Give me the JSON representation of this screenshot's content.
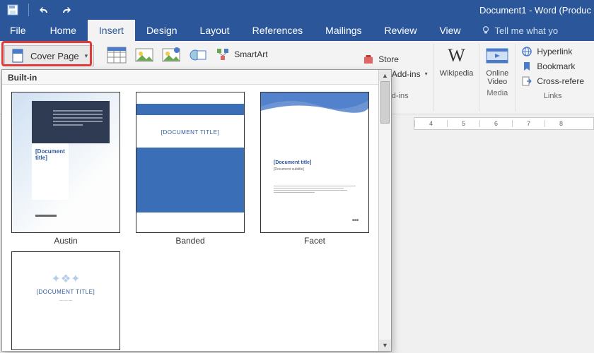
{
  "window": {
    "title": "Document1 - Word (Produc"
  },
  "qat": {
    "save": "Save",
    "undo": "Undo",
    "redo": "Redo"
  },
  "tabs": {
    "file": "File",
    "items": [
      "Home",
      "Insert",
      "Design",
      "Layout",
      "References",
      "Mailings",
      "Review",
      "View"
    ],
    "active_index": 1,
    "tellme": "Tell me what yo"
  },
  "ribbon": {
    "cover_page": "Cover Page",
    "smartart": "SmartArt",
    "store": "Store",
    "my_addins": "My Add-ins",
    "wikipedia": "Wikipedia",
    "online_video": "Online\nVideo",
    "hyperlink": "Hyperlink",
    "bookmark": "Bookmark",
    "crossref": "Cross-refere",
    "group_addins": "Add-ins",
    "group_media": "Media",
    "group_links": "Links"
  },
  "ruler": {
    "marks": [
      "4",
      "5",
      "6",
      "7",
      "8"
    ]
  },
  "gallery": {
    "header": "Built-in",
    "items": [
      {
        "name": "Austin",
        "title_text": "[Document\ntitle]"
      },
      {
        "name": "Banded",
        "title_text": "[DOCUMENT TITLE]"
      },
      {
        "name": "Facet",
        "title_text": "[Document title]",
        "subtitle": "[Document subtitle]"
      },
      {
        "name": "",
        "title_text": "[DOCUMENT TITLE]"
      }
    ]
  }
}
